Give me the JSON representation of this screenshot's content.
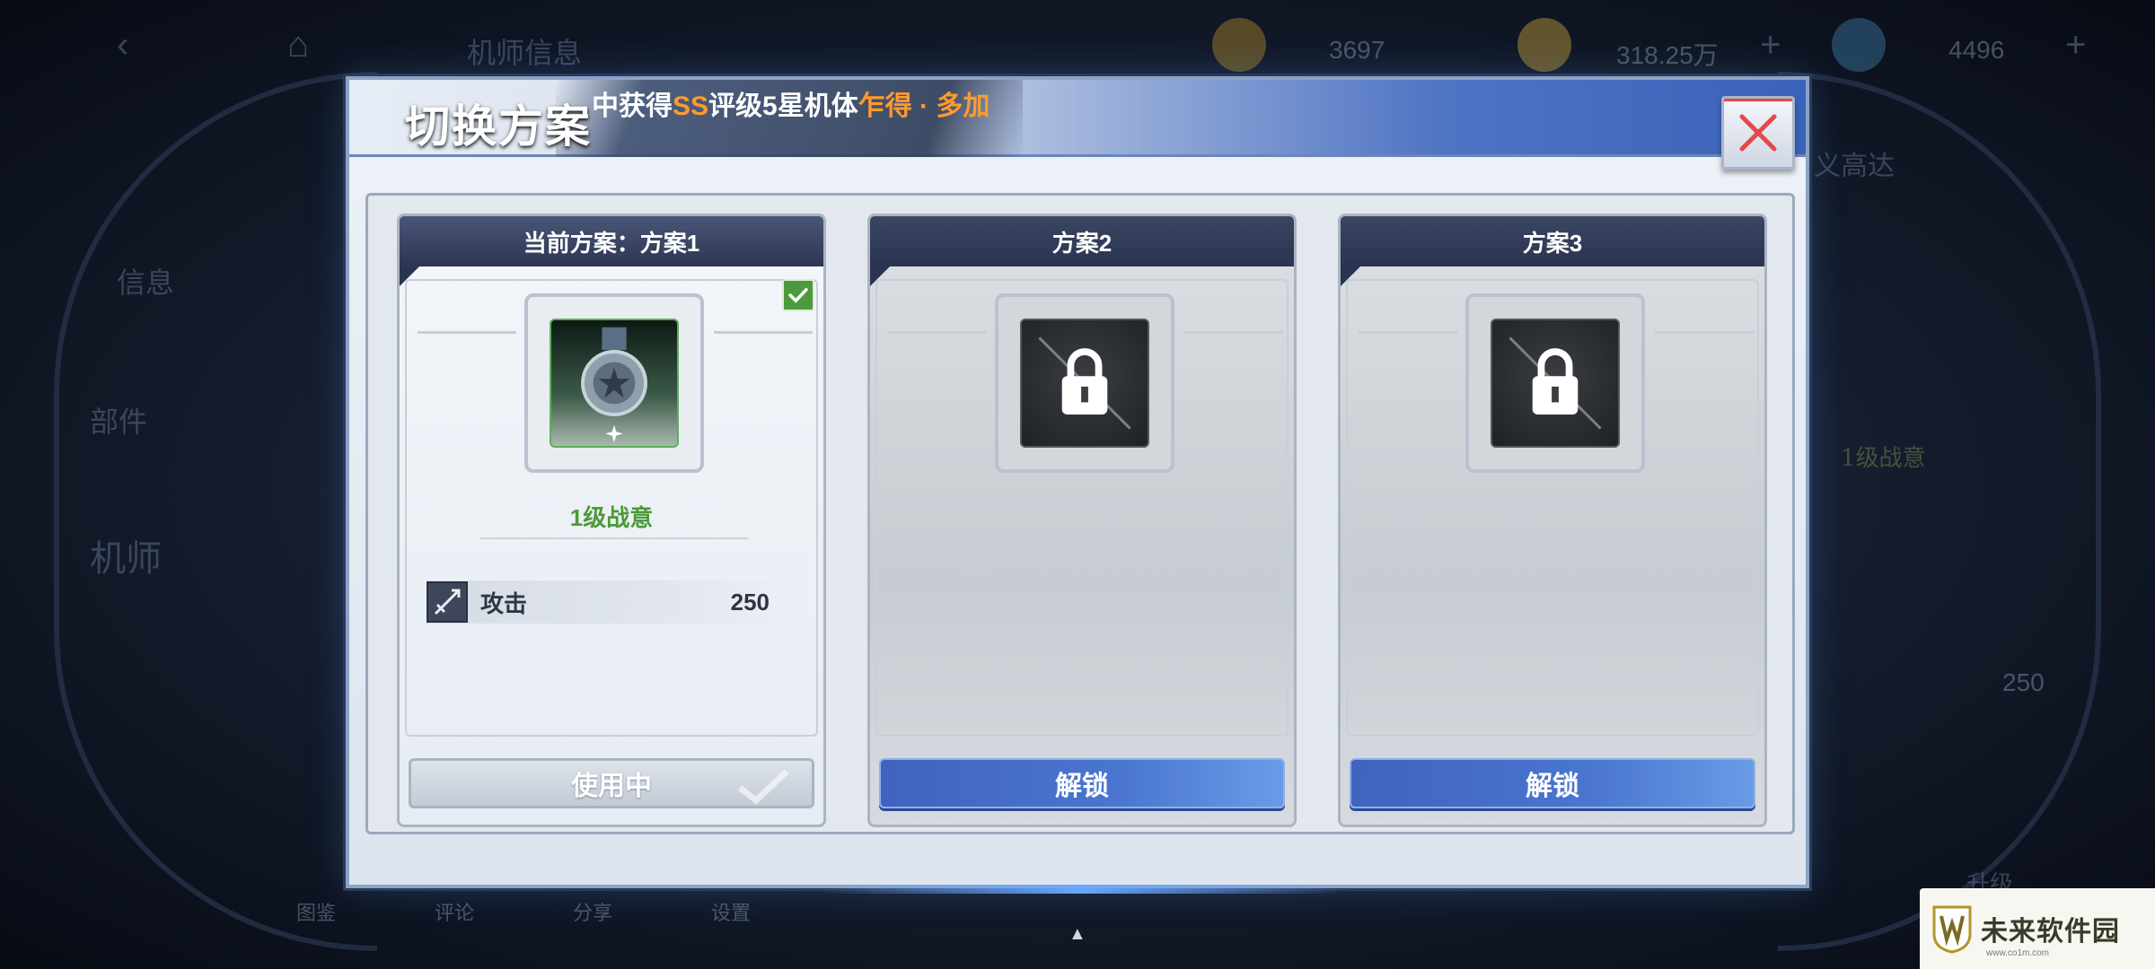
{
  "background": {
    "top_title": "机师信息",
    "currency_1": "3697",
    "currency_2": "318.25万",
    "currency_3": "4496",
    "side_tabs": [
      "信息",
      "部件",
      "机师"
    ],
    "right_label": "义高达",
    "right_level": "1级战意",
    "right_value": "250",
    "bottom_tabs": [
      "图鉴",
      "评论",
      "分享",
      "设置"
    ],
    "bottom_btn": "升级"
  },
  "dialog": {
    "title": "切换方案",
    "marquee_prefix": "中获得",
    "marquee_hl1": "SS",
    "marquee_mid": "评级5星机体",
    "marquee_hl2": "乍得 · 多加"
  },
  "cards": [
    {
      "header": "当前方案：方案1",
      "state": "active",
      "level": "1级战意",
      "stat_name": "攻击",
      "stat_value": "250",
      "button": "使用中"
    },
    {
      "header": "方案2",
      "state": "locked",
      "button": "解锁"
    },
    {
      "header": "方案3",
      "state": "locked",
      "button": "解锁"
    }
  ],
  "watermark": {
    "name": "未来软件园",
    "url": "www.co1m.com"
  },
  "colors": {
    "accent_blue": "#4a76d0",
    "level_green": "#4c9a3a",
    "close_red": "#e34949",
    "highlight_orange": "#ff9a2e"
  }
}
